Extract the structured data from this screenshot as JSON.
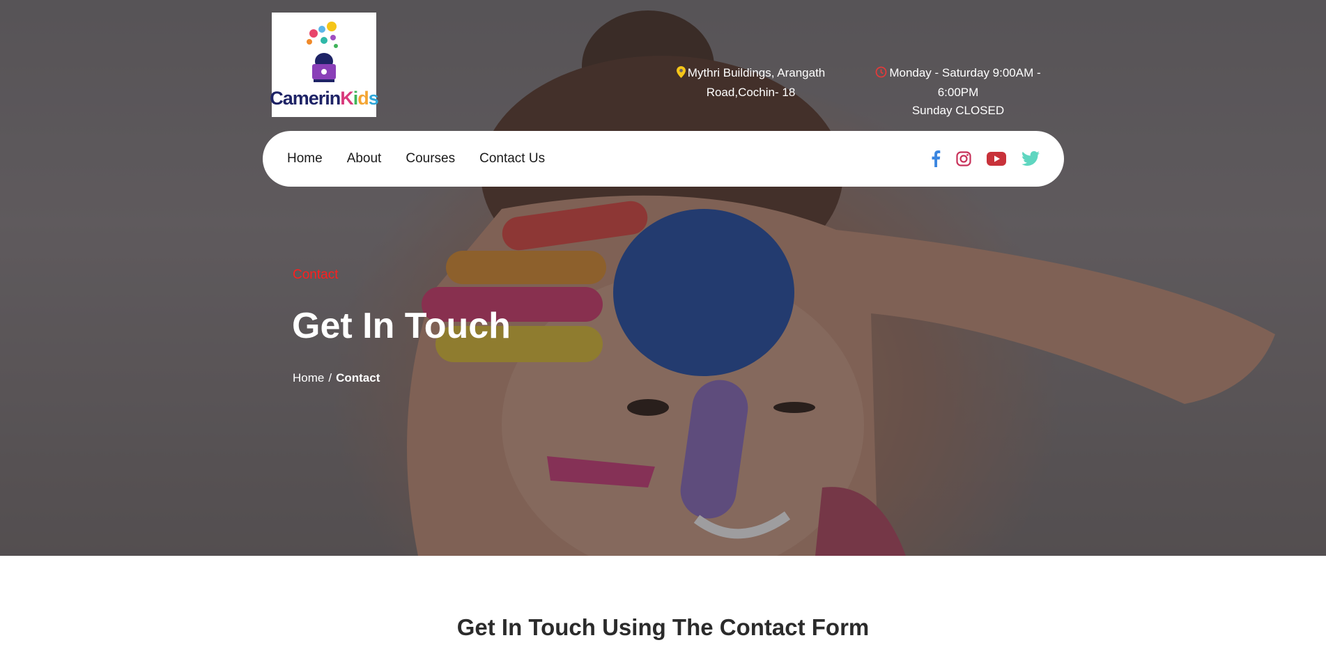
{
  "brand": {
    "logo_text_part1": "Camerin",
    "logo_text_part2_k": "K",
    "logo_text_part2_i": "i",
    "logo_text_part2_d": "d",
    "logo_text_part2_s": "s",
    "icon": "kid-with-balloons-logo"
  },
  "header": {
    "address": {
      "icon": "map-pin-icon",
      "line1": "Mythri Buildings, Arangath",
      "line2": "Road,Cochin- 18"
    },
    "hours": {
      "icon": "clock-icon",
      "line1": "Monday - Saturday 9:00AM - 6:00PM",
      "line2": "Sunday CLOSED"
    }
  },
  "nav": {
    "items": [
      {
        "label": "Home"
      },
      {
        "label": "About"
      },
      {
        "label": "Courses"
      },
      {
        "label": "Contact Us"
      }
    ],
    "socials": [
      {
        "name": "facebook-icon",
        "color": "#3b86e0"
      },
      {
        "name": "instagram-icon",
        "color": "#c8325a"
      },
      {
        "name": "youtube-icon",
        "color": "#c8323a"
      },
      {
        "name": "twitter-icon",
        "color": "#5fd6c0"
      }
    ]
  },
  "hero": {
    "eyebrow": "Contact",
    "title": "Get In Touch",
    "breadcrumb": {
      "home": "Home",
      "separator": "/",
      "current": "Contact"
    }
  },
  "section": {
    "title": "Get In Touch Using The Contact Form"
  },
  "colors": {
    "accent_red": "#ff1e1e",
    "pin_yellow": "#f5c518",
    "clock_red": "#e03b3b"
  }
}
